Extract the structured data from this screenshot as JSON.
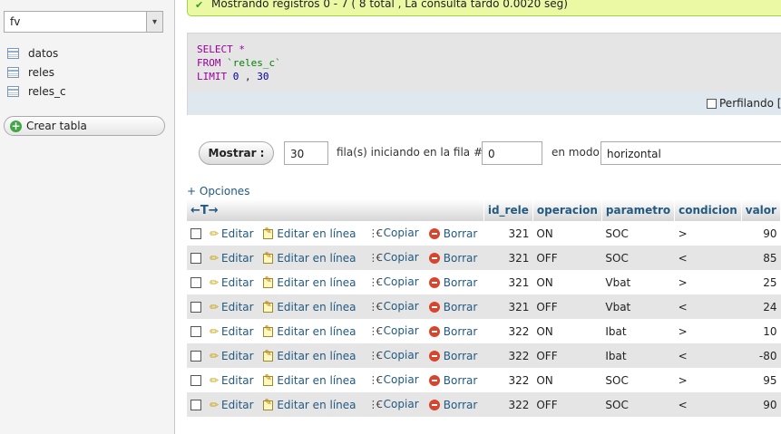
{
  "sidebar": {
    "db_select": "fv",
    "tables": [
      "datos",
      "reles",
      "reles_c"
    ],
    "create_table": "Crear tabla"
  },
  "message": "Mostrando registros 0 - 7 ( 8 total , La consulta tardó 0.0020 seg)",
  "sql": {
    "select_kw": "SELECT",
    "star": "*",
    "from_kw": "FROM",
    "table": "`reles_c`",
    "limit_kw": "LIMIT",
    "limit_offset": "0",
    "comma": ",",
    "limit_count": "30",
    "profiling_label": "Perfilando ["
  },
  "nav": {
    "show_button": "Mostrar :",
    "rows_value": "30",
    "rows_text": "fila(s) iniciando en la fila #",
    "start_value": "0",
    "mode_text": "en modo",
    "mode_value": "horizontal"
  },
  "options_link": "+ Opciones",
  "table": {
    "arrows": "←T→",
    "columns": [
      "id_rele",
      "operacion",
      "parametro",
      "condicion",
      "valor"
    ],
    "actions": {
      "edit": "Editar",
      "inline_edit": "Editar en línea",
      "copy": "Copiar",
      "delete": "Borrar"
    },
    "rows": [
      {
        "id_rele": "321",
        "operacion": "ON",
        "parametro": "SOC",
        "condicion": ">",
        "valor": "90"
      },
      {
        "id_rele": "321",
        "operacion": "OFF",
        "parametro": "SOC",
        "condicion": "<",
        "valor": "85"
      },
      {
        "id_rele": "321",
        "operacion": "ON",
        "parametro": "Vbat",
        "condicion": ">",
        "valor": "25"
      },
      {
        "id_rele": "321",
        "operacion": "OFF",
        "parametro": "Vbat",
        "condicion": "<",
        "valor": "24"
      },
      {
        "id_rele": "322",
        "operacion": "ON",
        "parametro": "Ibat",
        "condicion": ">",
        "valor": "10"
      },
      {
        "id_rele": "322",
        "operacion": "OFF",
        "parametro": "Ibat",
        "condicion": "<",
        "valor": "-80"
      },
      {
        "id_rele": "322",
        "operacion": "ON",
        "parametro": "SOC",
        "condicion": ">",
        "valor": "95"
      },
      {
        "id_rele": "322",
        "operacion": "OFF",
        "parametro": "SOC",
        "condicion": "<",
        "valor": "90"
      }
    ]
  },
  "colors": {
    "link": "#235a81",
    "success_bg": "#ebf8a4",
    "even_row": "#e5e5e5"
  }
}
